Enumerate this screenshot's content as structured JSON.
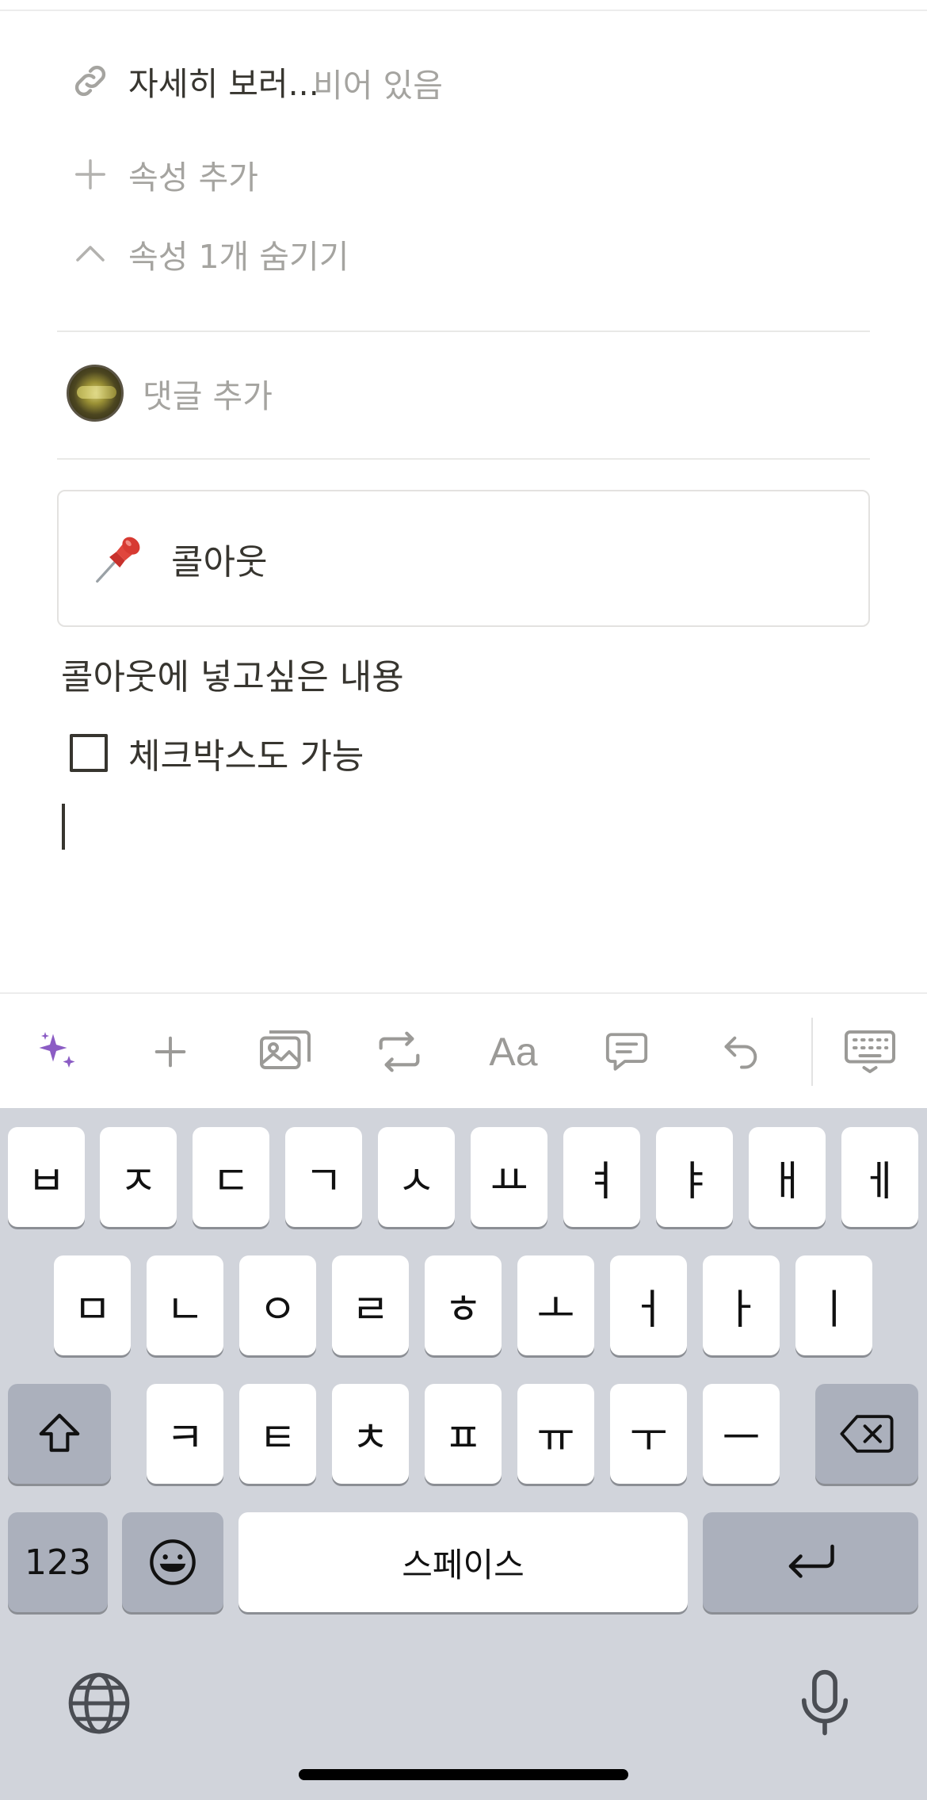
{
  "properties": {
    "url": {
      "name": "자세히 보러...",
      "value": "비어 있음"
    },
    "add_property": "속성 추가",
    "hide_properties": "속성 1개 숨기기"
  },
  "comment": {
    "placeholder": "댓글 추가"
  },
  "callout": {
    "emoji": "pushpin-icon",
    "text": "콜아웃"
  },
  "content": {
    "paragraph": "콜아웃에 넣고싶은 내용",
    "todo": {
      "text": "체크박스도 가능",
      "checked": false
    }
  },
  "toolbar": {
    "items": [
      "ai-sparkle-icon",
      "plus-icon",
      "image-icon",
      "turn-into-icon",
      "text-format",
      "comment-icon",
      "undo-icon",
      "keyboard-dismiss-icon"
    ],
    "text_format_label": "Aa",
    "ai_color": "#8b5cc4"
  },
  "keyboard": {
    "row1": [
      "ㅂ",
      "ㅈ",
      "ㄷ",
      "ㄱ",
      "ㅅ",
      "ㅛ",
      "ㅕ",
      "ㅑ",
      "ㅐ",
      "ㅔ"
    ],
    "row2": [
      "ㅁ",
      "ㄴ",
      "ㅇ",
      "ㄹ",
      "ㅎ",
      "ㅗ",
      "ㅓ",
      "ㅏ",
      "ㅣ"
    ],
    "row3": [
      "ㅋ",
      "ㅌ",
      "ㅊ",
      "ㅍ",
      "ㅠ",
      "ㅜ",
      "ㅡ"
    ],
    "numbers_label": "123",
    "space_label": "스페이스"
  }
}
